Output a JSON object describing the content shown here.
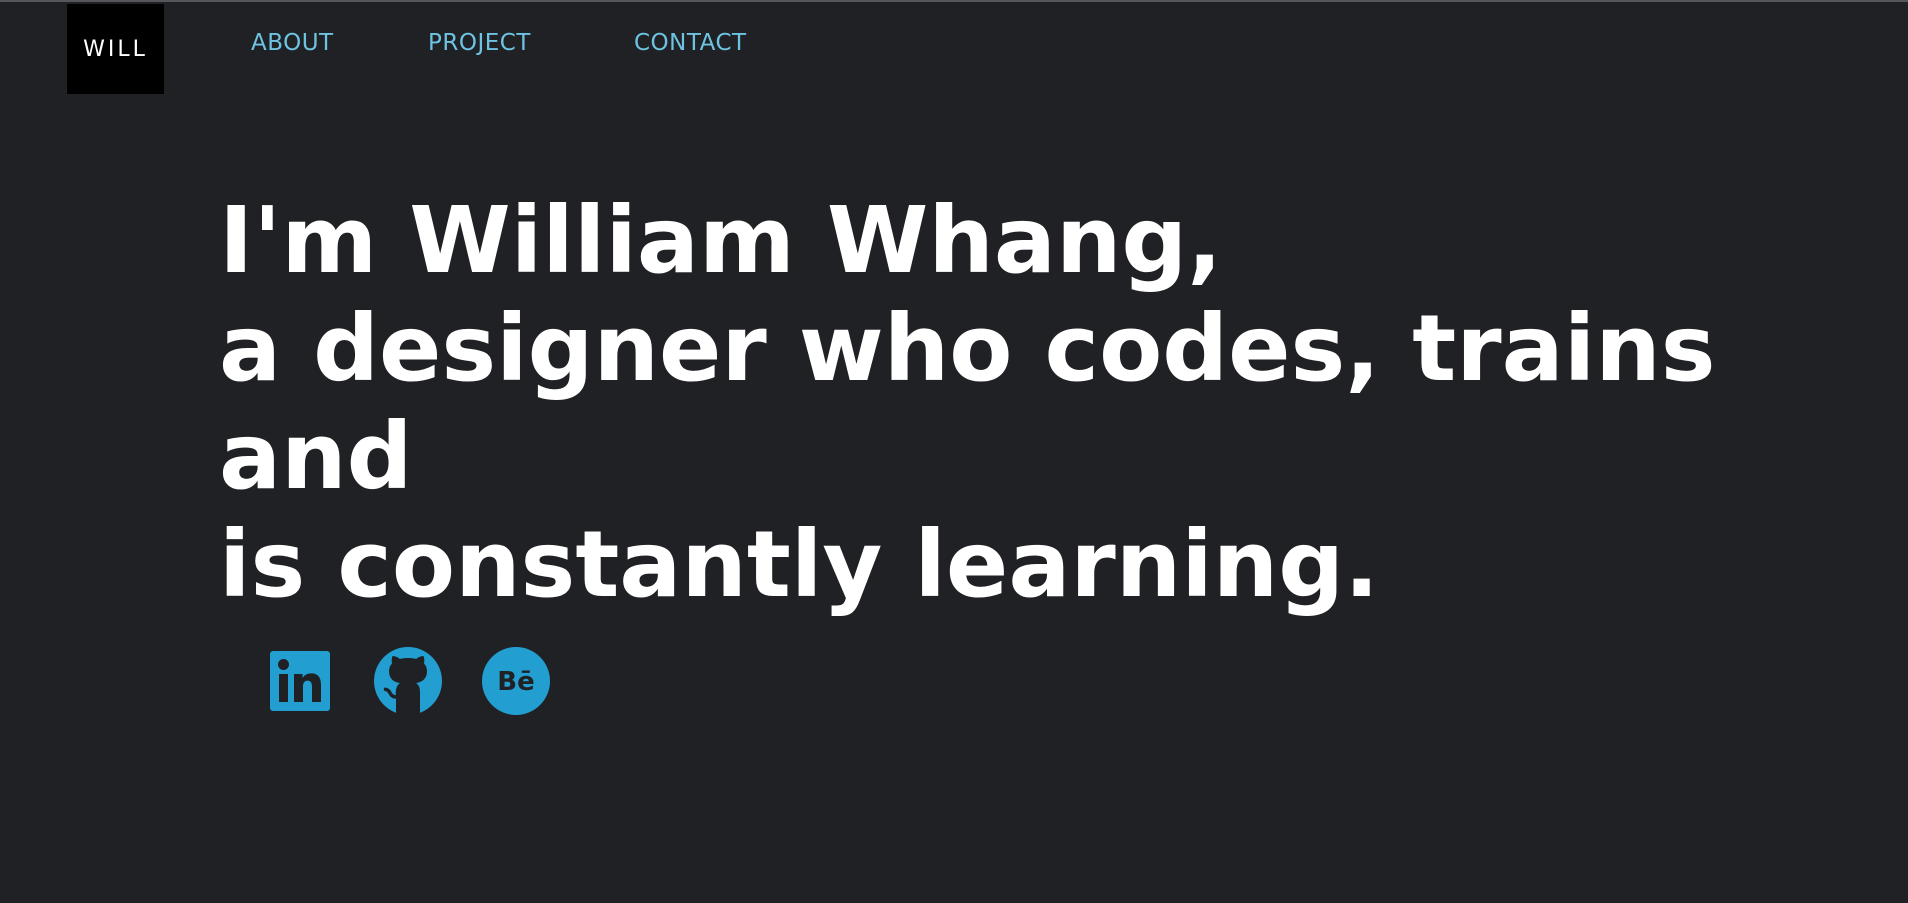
{
  "brand": {
    "logo_text": "WILL"
  },
  "nav": {
    "items": [
      {
        "label": "ABOUT"
      },
      {
        "label": "PROJECT"
      },
      {
        "label": "CONTACT"
      }
    ]
  },
  "hero": {
    "lines": [
      "I'm William Whang,",
      "a designer who codes, trains",
      "and",
      "is constantly learning."
    ]
  },
  "social": {
    "icons": [
      "linkedin-icon",
      "github-icon",
      "behance-icon"
    ],
    "behance_glyph": "Bē"
  },
  "colors": {
    "background": "#202125",
    "nav_link": "#6ec3e2",
    "icon_accent": "#229fd0",
    "hero_text": "#ffffff",
    "logo_bg": "#000000"
  }
}
